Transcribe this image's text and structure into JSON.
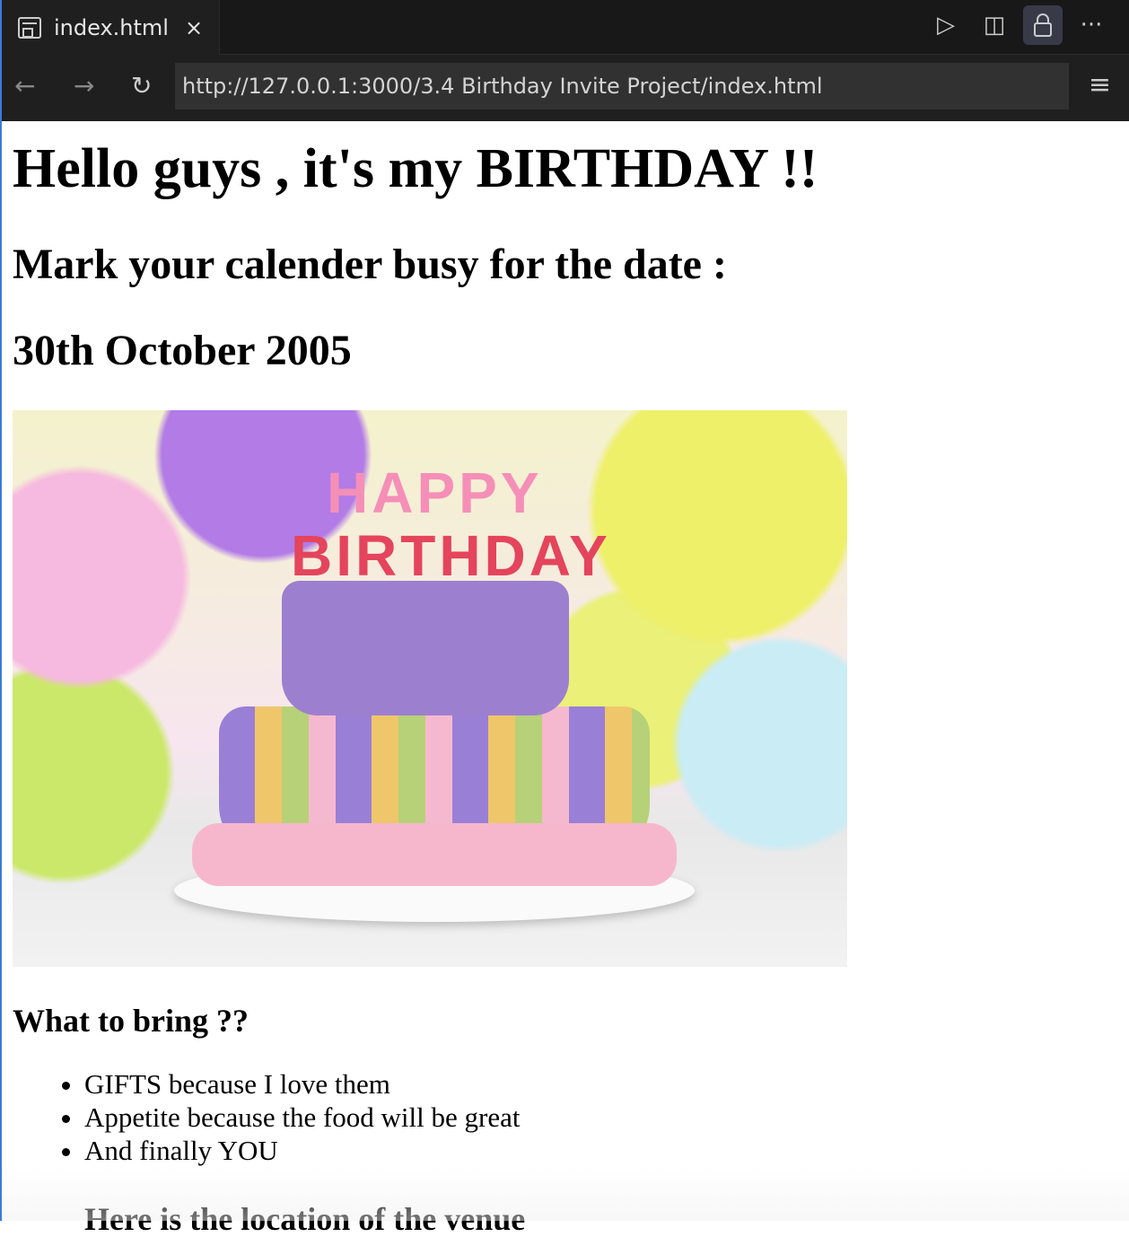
{
  "tab": {
    "title": "index.html",
    "close": "×"
  },
  "toolbar": {
    "run": "▷",
    "split": "◫",
    "lock": "🔒",
    "more": "···"
  },
  "nav": {
    "back": "←",
    "forward": "→",
    "reload": "↻",
    "url": "http://127.0.0.1:3000/3.4 Birthday Invite Project/index.html",
    "menu": "≡"
  },
  "page": {
    "heading": "Hello guys , it's my BIRTHDAY !!",
    "subheading": "Mark your calender busy for the date :",
    "date": "30th October 2005",
    "image_text": {
      "line1": "HAPPY",
      "line2": "BIRTHDAY"
    },
    "bring_heading": "What to bring ??",
    "bring_items": [
      "GIFTS because I love them",
      "Appetite because the food will be great",
      "And finally YOU"
    ],
    "location_heading": "Here is the location of the venue"
  }
}
